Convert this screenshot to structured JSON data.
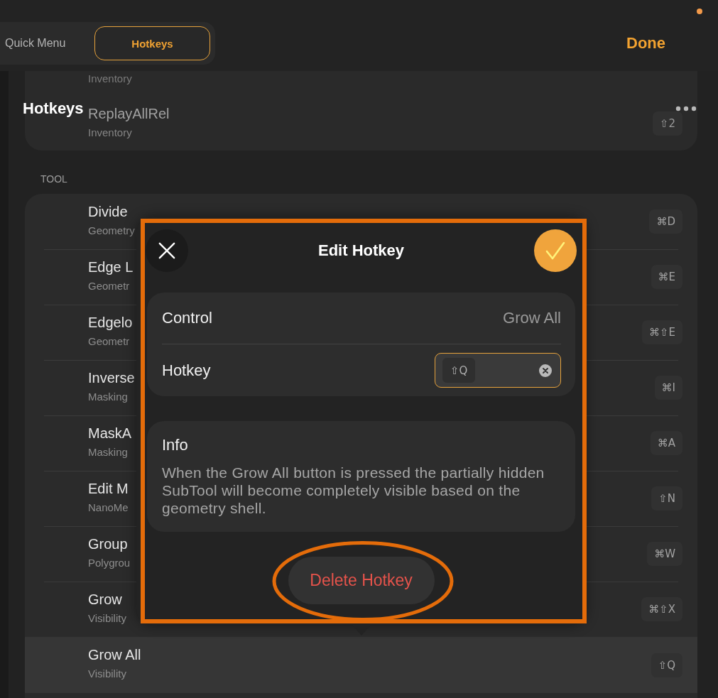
{
  "top_bar": {
    "tabs": [
      {
        "label": "Quick Menu",
        "selected": false
      },
      {
        "label": "Hotkeys",
        "selected": true
      }
    ],
    "done_button": "Done"
  },
  "header": {
    "title": "Hotkeys"
  },
  "scrolled_rows": [
    {
      "category": "Inventory"
    },
    {
      "name": "ReplayAllRel",
      "category": "Inventory",
      "hotkey": "⇧2"
    }
  ],
  "section": {
    "label": "TOOL",
    "rows": [
      {
        "name": "Divide",
        "category": "Geometry",
        "hotkey": "⌘D",
        "selected": false
      },
      {
        "name": "Edge L",
        "category": "Geometr",
        "hotkey": "⌘E",
        "selected": false
      },
      {
        "name": "Edgelo",
        "category": "Geometr",
        "hotkey": "⌘⇧E",
        "selected": false
      },
      {
        "name": "Inverse",
        "category": "Masking",
        "hotkey": "⌘I",
        "selected": false
      },
      {
        "name": "MaskA",
        "category": "Masking",
        "hotkey": "⌘A",
        "selected": false
      },
      {
        "name": "Edit M",
        "category": "NanoMe",
        "hotkey": "⇧N",
        "selected": false
      },
      {
        "name": "Group",
        "category": "Polygrou",
        "hotkey": "⌘W",
        "selected": false
      },
      {
        "name": "Grow",
        "category": "Visibility",
        "hotkey": "⌘⇧X",
        "selected": false
      },
      {
        "name": "Grow All",
        "category": "Visibility",
        "hotkey": "⇧Q",
        "selected": true
      }
    ]
  },
  "dialog": {
    "title": "Edit Hotkey",
    "fields": [
      {
        "kind": "text",
        "label": "Control",
        "value": "Grow All"
      },
      {
        "kind": "hotkey",
        "label": "Hotkey",
        "value": "⇧Q"
      }
    ],
    "info_title": "Info",
    "info_text": "When the Grow All button is pressed the partially hidden SubTool will become completely visible based on the geometry shell.",
    "delete_button": "Delete Hotkey"
  }
}
